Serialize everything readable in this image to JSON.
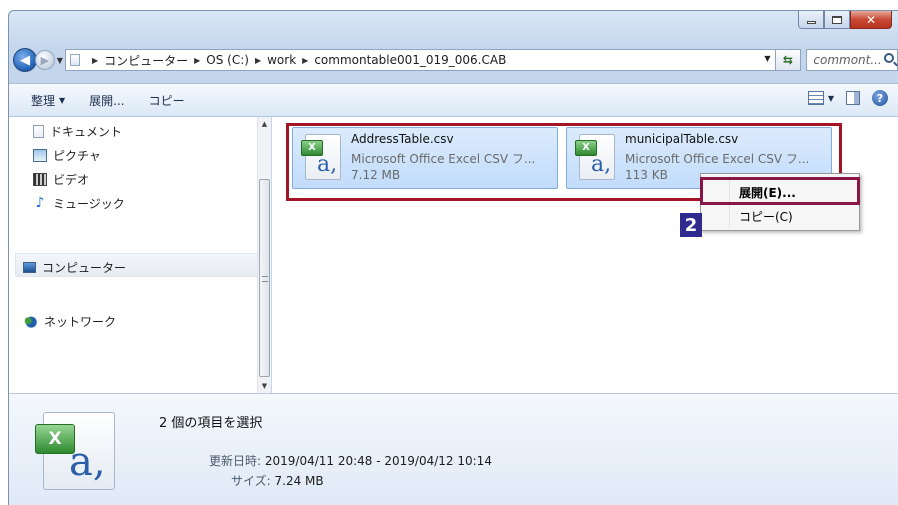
{
  "window": {
    "address": {
      "crumbs": [
        "コンピューター",
        "OS (C:)",
        "work",
        "commontable001_019_006.CAB"
      ]
    },
    "search": {
      "placeholder": "commont..."
    }
  },
  "toolbar": {
    "organize_label": "整理",
    "extract_label": "展開...",
    "copy_label": "コピー"
  },
  "nav": {
    "items": [
      {
        "label": "ドキュメント",
        "icon": "documents-icon"
      },
      {
        "label": "ピクチャ",
        "icon": "pictures-icon"
      },
      {
        "label": "ビデオ",
        "icon": "video-icon"
      },
      {
        "label": "ミュージック",
        "icon": "music-icon"
      },
      {
        "label": "コンピューター",
        "icon": "computer-icon"
      },
      {
        "label": "ネットワーク",
        "icon": "network-icon"
      }
    ]
  },
  "files": [
    {
      "name": "AddressTable.csv",
      "type": "Microsoft Office Excel CSV フ...",
      "size": "7.12 MB"
    },
    {
      "name": "municipalTable.csv",
      "type": "Microsoft Office Excel CSV フ...",
      "size": "113 KB"
    }
  ],
  "context_menu": {
    "items": [
      {
        "label": "展開(E)..."
      },
      {
        "label": "コピー(C)"
      }
    ]
  },
  "badge": "2",
  "details": {
    "title": "2 個の項目を選択",
    "modified_label": "更新日時:",
    "modified_value": "2019/04/11 20:48 - 2019/04/12 10:14",
    "size_label": "サイズ:",
    "size_value": "7.24 MB"
  },
  "colors": {
    "selection_outline": "#a31425",
    "menu_highlight_outline": "#8a1648",
    "badge_bg": "#2e2a8e"
  }
}
